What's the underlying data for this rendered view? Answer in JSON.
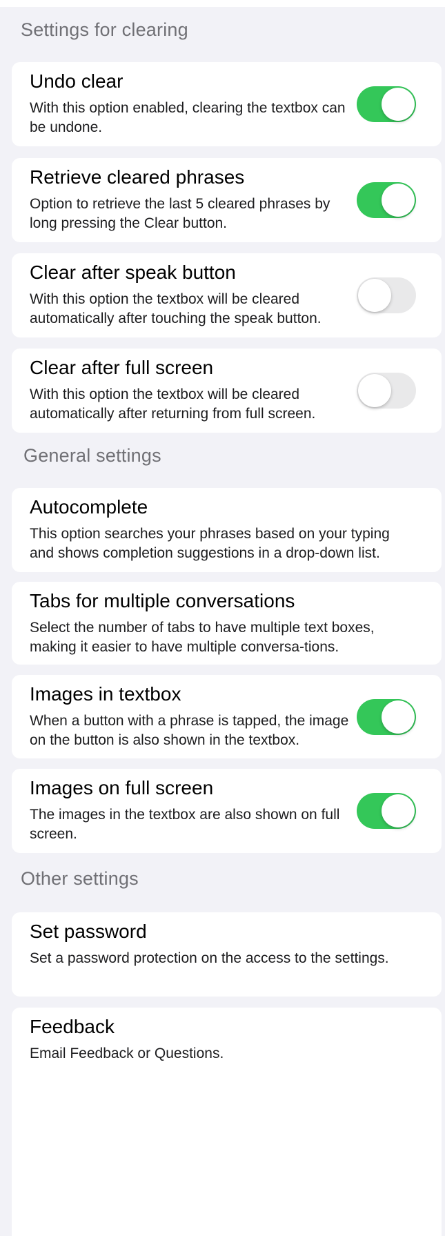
{
  "colors": {
    "background": "#f2f2f7",
    "card": "#ffffff",
    "toggle_on": "#34c759",
    "toggle_off": "#e9e9ea",
    "section_header": "#707075"
  },
  "sections": [
    {
      "header": "Settings for clearing",
      "items": [
        {
          "title": "Undo clear",
          "description": "With this option enabled, clearing the textbox can be undone.",
          "toggle": "on"
        },
        {
          "title": "Retrieve cleared phrases",
          "description": "Option to retrieve the last 5 cleared phrases by long pressing the Clear button.",
          "toggle": "on"
        },
        {
          "title": "Clear after speak button",
          "description": "With this option the textbox will be cleared automatically after touching the speak button.",
          "toggle": "off"
        },
        {
          "title": "Clear after full screen",
          "description": "With this option the textbox will be cleared automatically after returning from full screen.",
          "toggle": "off"
        }
      ]
    },
    {
      "header": "General settings",
      "items": [
        {
          "title": "Autocomplete",
          "description": "This option searches your phrases based on your typing and shows completion suggestions in a drop-down list."
        },
        {
          "title": "Tabs for multiple conversations",
          "description": "Select the number of tabs to have multiple text boxes, making it easier to have multiple conversa-tions."
        },
        {
          "title": "Images in textbox",
          "description": "When a button with a phrase is tapped, the image on the button is also shown in the textbox.",
          "toggle": "on"
        },
        {
          "title": "Images on full screen",
          "description": "The images in the textbox are also shown on full screen.",
          "toggle": "on"
        }
      ]
    },
    {
      "header": "Other settings",
      "items": [
        {
          "title": "Set password",
          "description": "Set a password protection on the access to the settings."
        },
        {
          "title": "Feedback",
          "description": "Email Feedback or Questions."
        }
      ]
    }
  ]
}
